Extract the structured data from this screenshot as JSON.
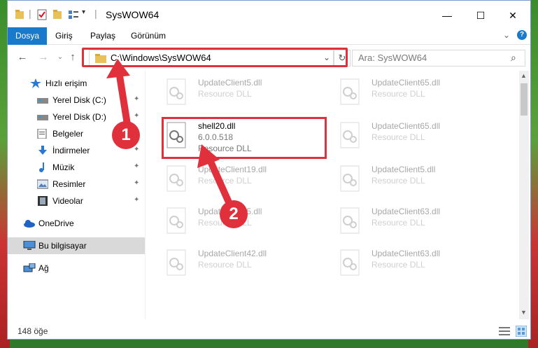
{
  "window": {
    "title": "SysWOW64",
    "minimize": "—",
    "maximize": "☐",
    "close": "✕"
  },
  "ribbon": {
    "tabs": [
      "Dosya",
      "Giriş",
      "Paylaş",
      "Görünüm"
    ],
    "expand": "⌄",
    "help": "?"
  },
  "nav": {
    "back": "←",
    "forward": "→",
    "recent": "⌄",
    "up": "↑",
    "address": "C:\\Windows\\SysWOW64",
    "addr_dropdown": "⌄",
    "refresh": "↻",
    "search_placeholder": "Ara: SysWOW64",
    "search_glyph": "⌕"
  },
  "sidebar": {
    "pin_glyph": "✦",
    "items": [
      {
        "label": "Hızlı erişim",
        "icon": "star-icon",
        "pinned": false
      },
      {
        "label": "Yerel Disk (C:)",
        "icon": "drive-icon",
        "pinned": true
      },
      {
        "label": "Yerel Disk (D:)",
        "icon": "drive-icon",
        "pinned": true
      },
      {
        "label": "Belgeler",
        "icon": "documents-icon",
        "pinned": true
      },
      {
        "label": "İndirmeler",
        "icon": "download-icon",
        "pinned": true
      },
      {
        "label": "Müzik",
        "icon": "music-icon",
        "pinned": true
      },
      {
        "label": "Resimler",
        "icon": "pictures-icon",
        "pinned": true
      },
      {
        "label": "Videolar",
        "icon": "videos-icon",
        "pinned": true
      },
      {
        "label": "OneDrive",
        "icon": "cloud-icon",
        "pinned": false
      },
      {
        "label": "Bu bilgisayar",
        "icon": "computer-icon",
        "pinned": false,
        "selected": true
      },
      {
        "label": "Ağ",
        "icon": "network-icon",
        "pinned": false
      }
    ]
  },
  "files": {
    "col1": [
      {
        "name": "UpdateClient5.dll",
        "type": "Resource DLL"
      },
      {
        "name": "shell20.dll",
        "version": "6.0.0.518",
        "type": "Resource DLL"
      },
      {
        "name": "UpdateClient19.dll",
        "type": "Resource DLL"
      },
      {
        "name": "UpdateClient5.dll",
        "type": "Resource DLL"
      },
      {
        "name": "UpdateClient42.dll",
        "type": "Resource DLL"
      }
    ],
    "col2": [
      {
        "name": "UpdateClient65.dll",
        "type": "Resource DLL"
      },
      {
        "name": "UpdateClient65.dll",
        "type": "Resource DLL"
      },
      {
        "name": "UpdateClient5.dll",
        "type": "Resource DLL"
      },
      {
        "name": "UpdateClient63.dll",
        "type": "Resource DLL"
      },
      {
        "name": "UpdateClient63.dll",
        "type": "Resource DLL"
      }
    ]
  },
  "annotations": {
    "step1": "1",
    "step2": "2",
    "color": "#e0303b"
  },
  "status": {
    "count": "148 öğe"
  }
}
